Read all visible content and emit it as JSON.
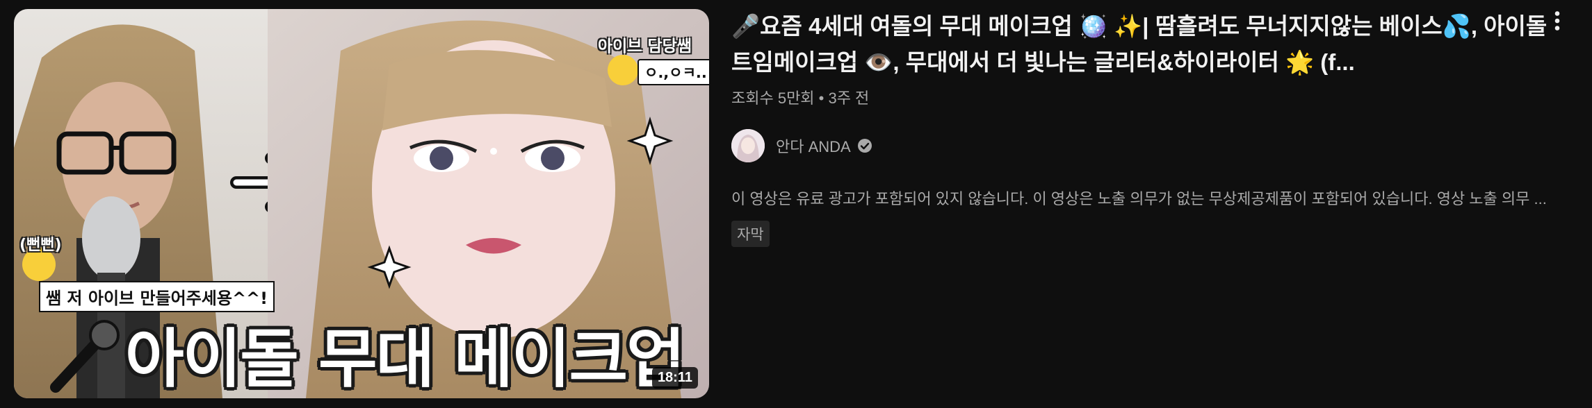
{
  "video": {
    "title": "🎤요즘 4세대 여돌의 무대 메이크업 🪩 ✨| 땀흘려도 무너지지않는 베이스💦, 아이돌 트임메이크업 👁️, 무대에서 더 빛나는 글리터&하이라이터 🌟 (f...",
    "stats": "조회수 5만회 • 3주 전",
    "duration": "18:11",
    "description": "이 영상은 유료 광고가 포함되어 있지 않습니다. 이 영상은 노출 의무가 없는 무상제공제품이 포함되어 있습니다. 영상 노출 의무 ...",
    "badge": "자막"
  },
  "thumbnail": {
    "overlay_main": "아이돌 무대 메이크업",
    "overlay_side": "아이브 담당쌤",
    "overlay_bubble": "ㅇ.,ㅇㅋ..",
    "overlay_left": "(뻔뻔)",
    "overlay_caption": "쌤 저 아이브 만들어주세용^^!"
  },
  "channel": {
    "name": "안다 ANDA",
    "verified_icon": "verified-check-icon"
  },
  "icons": {
    "more": "more-vert-icon"
  },
  "colors": {
    "background": "#0f0f0f",
    "title": "#f1f1f1",
    "secondary": "#aaaaaa",
    "badge_bg": "#272727"
  }
}
